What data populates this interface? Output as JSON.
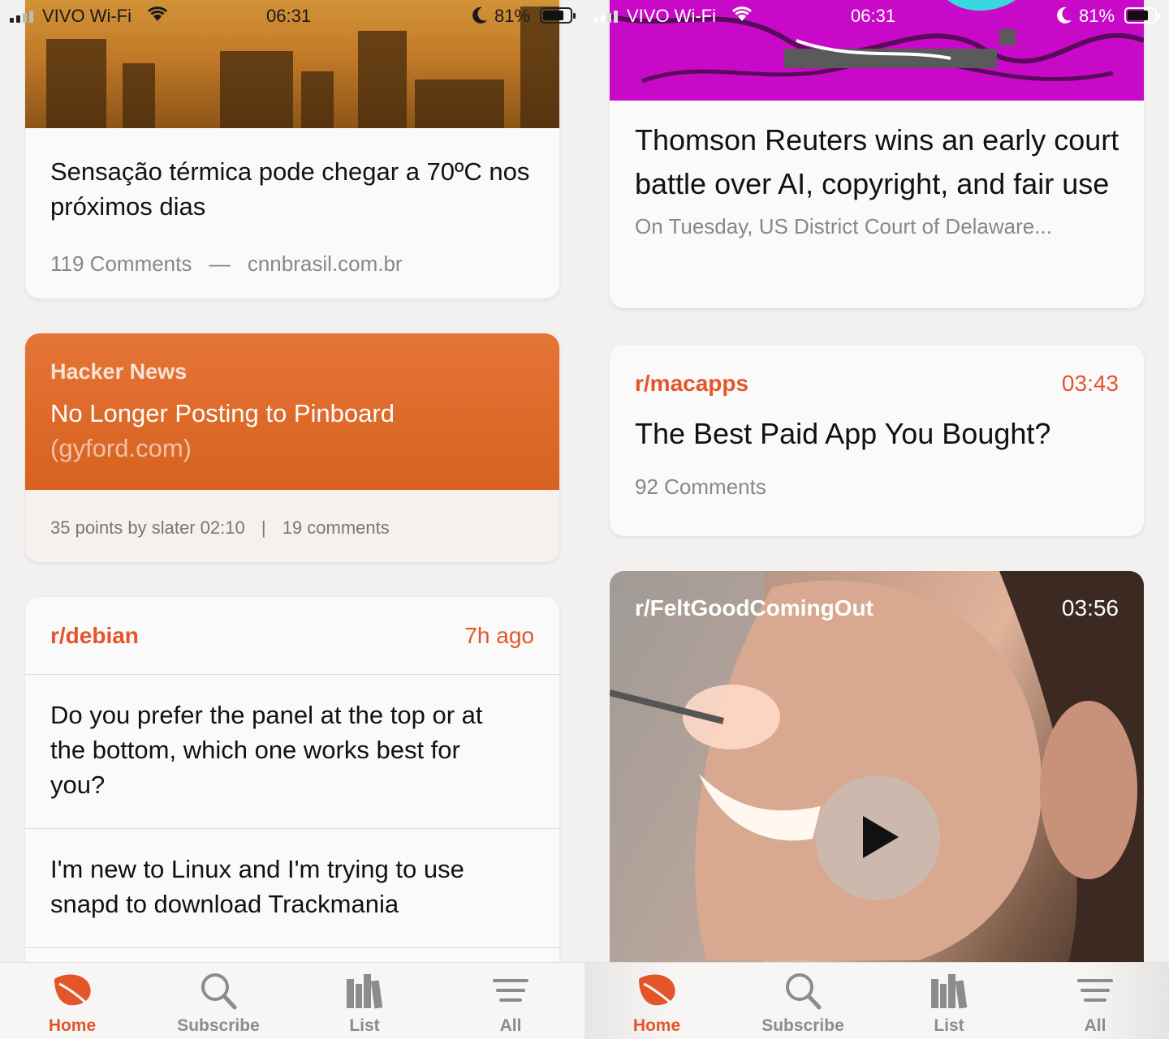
{
  "status_bar": {
    "carrier": "VIVO Wi-Fi",
    "time": "06:31",
    "battery": "81%"
  },
  "left": {
    "news_card": {
      "title": "Sensação térmica pode chegar a 70ºC nos próximos dias",
      "comments": "119 Comments",
      "separator": "—",
      "domain": "cnnbrasil.com.br"
    },
    "hn_card": {
      "source": "Hacker News",
      "title": "No Longer Posting to Pinboard",
      "domain": "(gyford.com)",
      "meta": "35 points by slater 02:10",
      "meta_sep": "|",
      "comments": "19 comments"
    },
    "reddit_card": {
      "subreddit": "r/debian",
      "time": "7h ago",
      "posts": [
        "Do you prefer the panel at the top or at the bottom, which one works best for you?",
        "I'm new to Linux and I'm trying to use snapd to download Trackmania"
      ]
    }
  },
  "right": {
    "news_card": {
      "title": "Thomson Reuters wins an early court battle over AI, copyright, and fair use",
      "excerpt": "On Tuesday, US District Court of Delaware..."
    },
    "reddit_card": {
      "subreddit": "r/macapps",
      "time": "03:43",
      "title": "The Best Paid App You Bought?",
      "comments": "92 Comments"
    },
    "video_card": {
      "subreddit": "r/FeltGoodComingOut",
      "time": "03:56"
    }
  },
  "tabs": [
    {
      "label": "Home",
      "icon": "leaf-icon",
      "active": true
    },
    {
      "label": "Subscribe",
      "icon": "search-icon",
      "active": false
    },
    {
      "label": "List",
      "icon": "books-icon",
      "active": false
    },
    {
      "label": "All",
      "icon": "menu-lines-icon",
      "active": false
    }
  ],
  "colors": {
    "accent": "#e5552a",
    "hn_orange": "#e06a2b",
    "glitch_magenta": "#c80ac8"
  }
}
